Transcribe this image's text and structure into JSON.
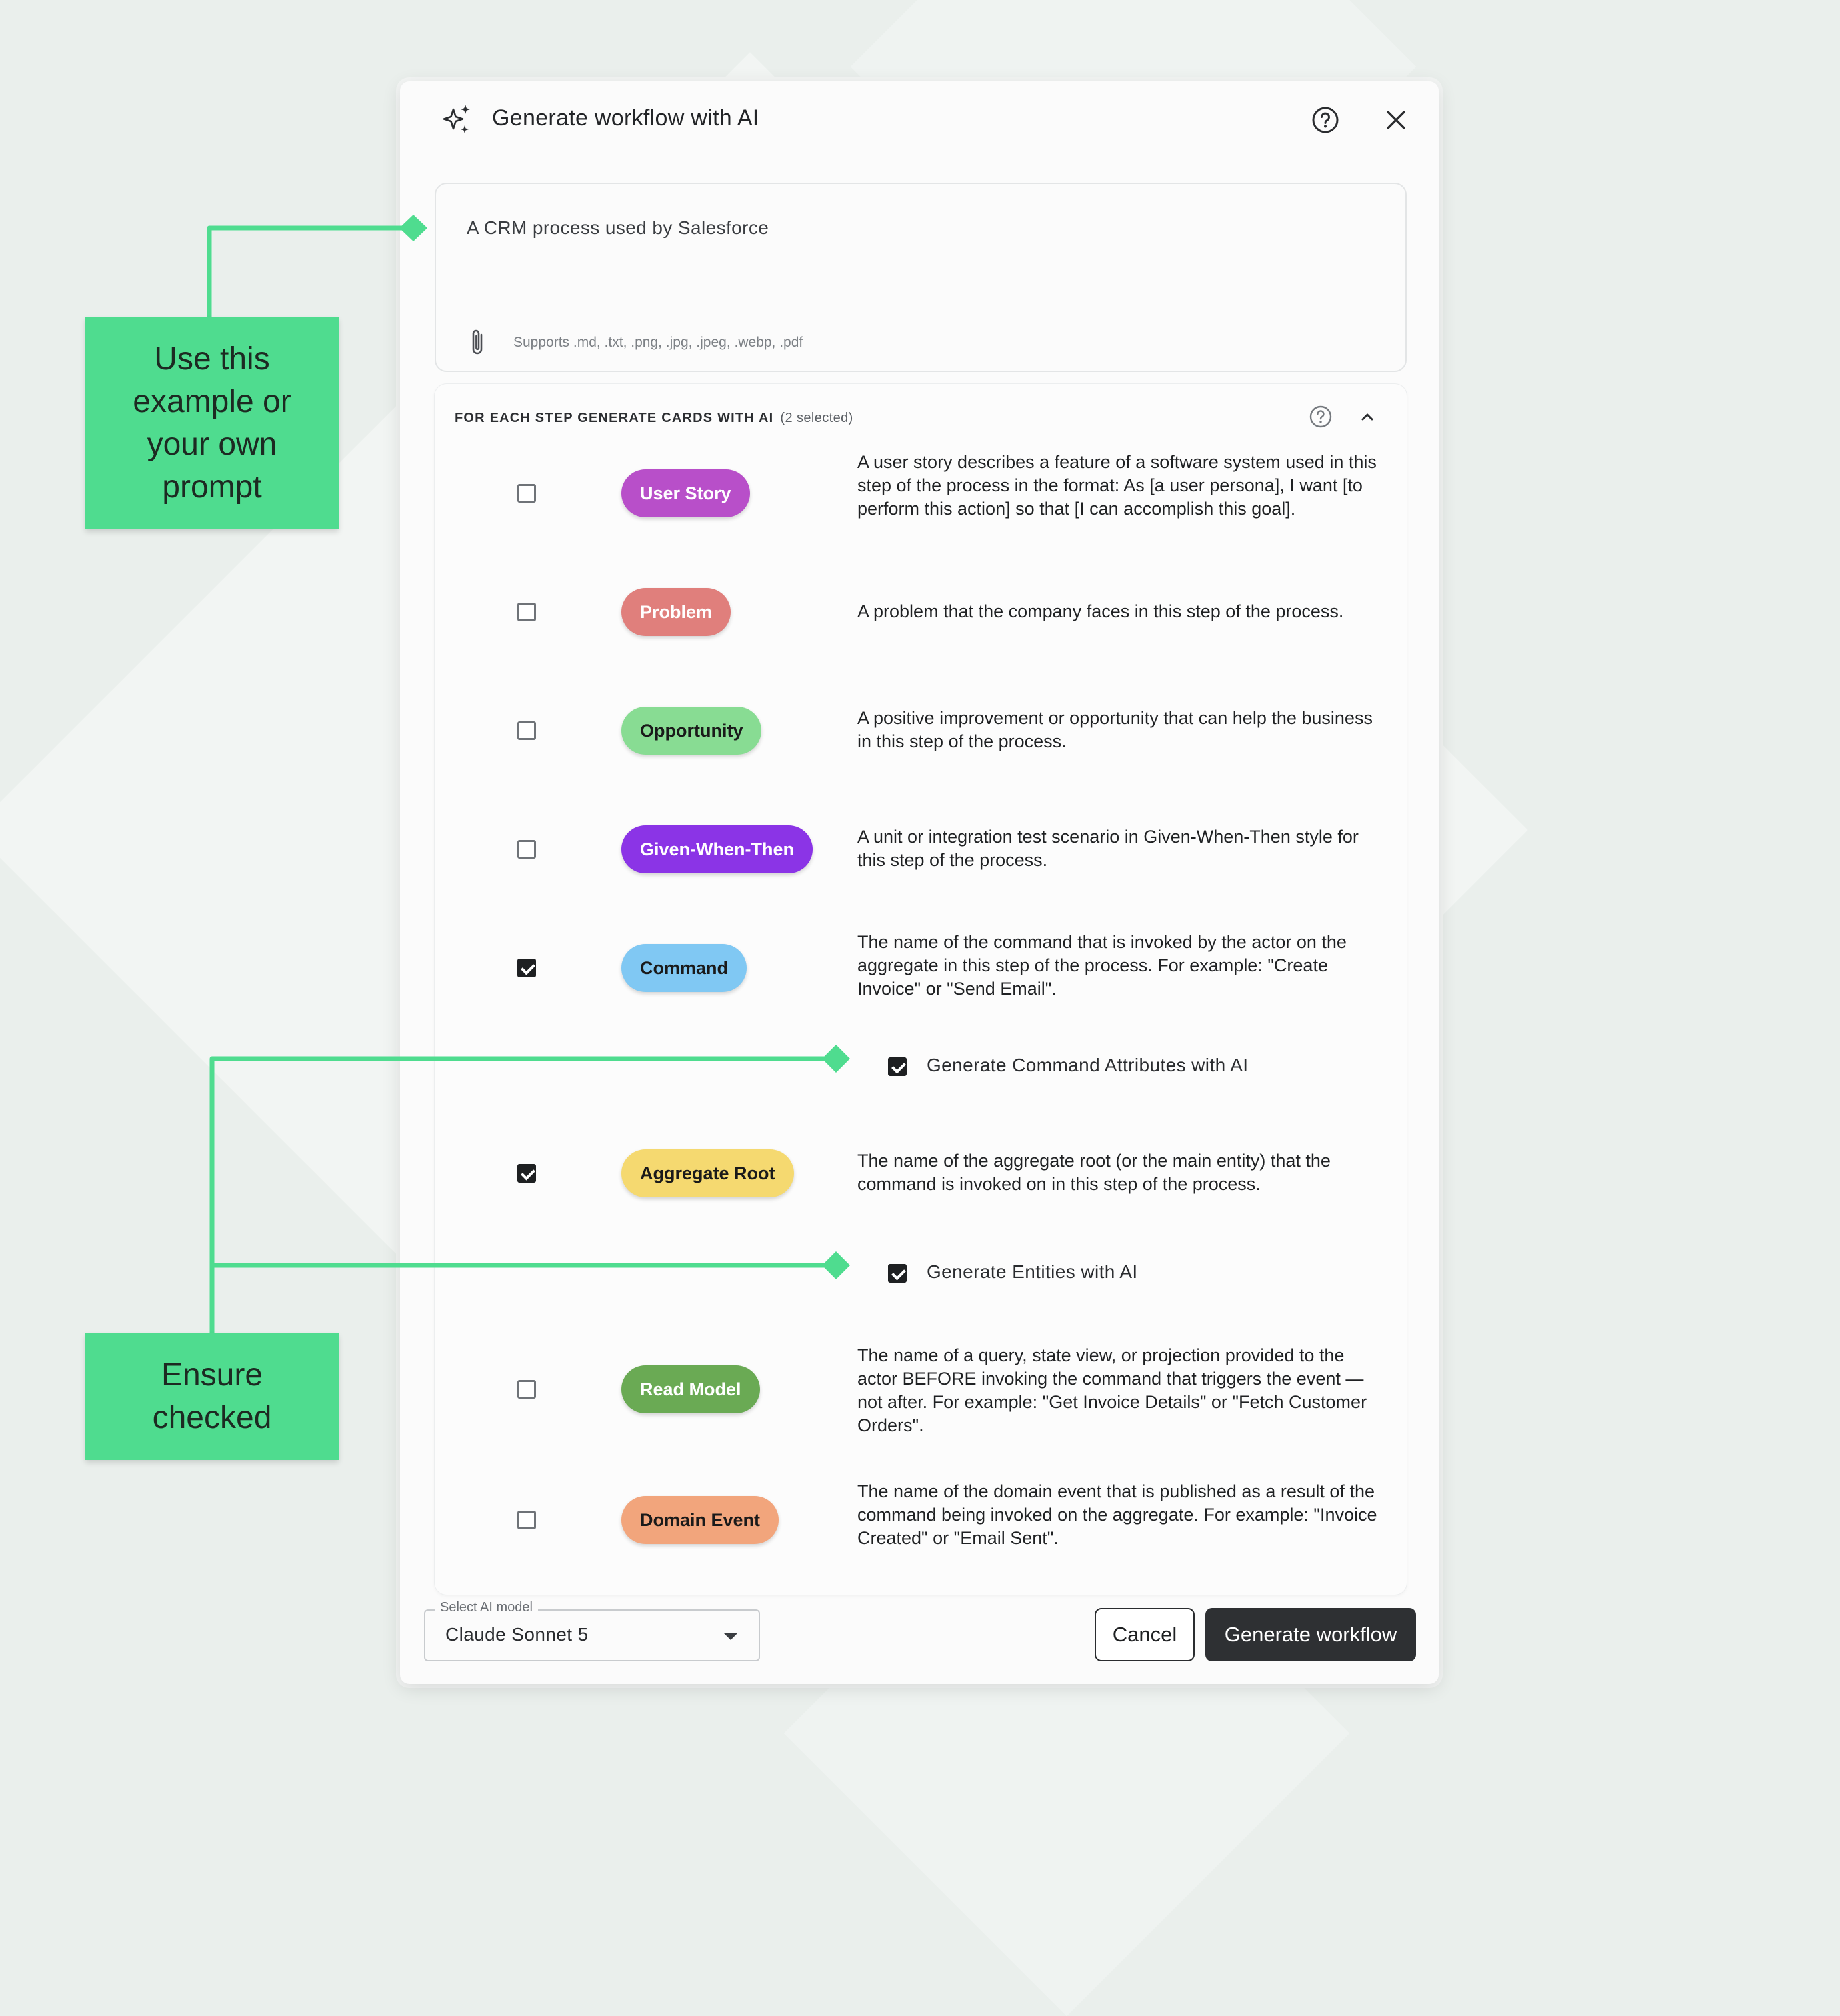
{
  "dialog": {
    "title": "Generate workflow with AI",
    "prompt_value": "A CRM process used by Salesforce",
    "supports_text": "Supports .md, .txt, .png, .jpg, .jpeg, .webp, .pdf"
  },
  "cards_section": {
    "title": "FOR EACH STEP GENERATE CARDS WITH AI",
    "selected_count": "(2 selected)",
    "cards": [
      {
        "label": "User Story",
        "checked": false,
        "color": "#b84fc9",
        "text_color": "#ffffff",
        "description": "A user story describes a feature of a software system used in this step of the process in the format: As [a user persona], I want [to perform this action] so that [I can accomplish this goal]."
      },
      {
        "label": "Problem",
        "checked": false,
        "color": "#e07f7c",
        "text_color": "#ffffff",
        "description": "A problem that the company faces in this step of the process."
      },
      {
        "label": "Opportunity",
        "checked": false,
        "color": "#88dc93",
        "text_color": "#1a1a1a",
        "description": "A positive improvement or opportunity that can help the business in this step of the process."
      },
      {
        "label": "Given-When-Then",
        "checked": false,
        "color": "#8b34e6",
        "text_color": "#ffffff",
        "description": "A unit or integration test scenario in Given-When-Then style for this step of the process."
      },
      {
        "label": "Command",
        "checked": true,
        "color": "#80c8f3",
        "text_color": "#1a1a1a",
        "description": "The name of the command that is invoked by the actor on the aggregate in this step of the process. For example: \"Create Invoice\" or \"Send Email\"."
      },
      {
        "label": "Aggregate Root",
        "checked": true,
        "color": "#f5d970",
        "text_color": "#1a1a1a",
        "description": "The name of the aggregate root (or the main entity) that the command is invoked on in this step of the process."
      },
      {
        "label": "Read Model",
        "checked": false,
        "color": "#6aaa54",
        "text_color": "#ffffff",
        "description": "The name of a query, state view, or projection provided to the actor BEFORE invoking the command that triggers the event — not after. For example: \"Get Invoice Details\" or \"Fetch Customer Orders\"."
      },
      {
        "label": "Domain Event",
        "checked": false,
        "color": "#f2a57c",
        "text_color": "#1a1a1a",
        "description": "The name of the domain event that is published as a result of the command being invoked on the aggregate. For example: \"Invoice Created\" or \"Email Sent\"."
      }
    ],
    "sub_options": [
      {
        "label": "Generate Command Attributes with AI",
        "checked": true
      },
      {
        "label": "Generate Entities with AI",
        "checked": true
      }
    ]
  },
  "footer": {
    "model_legend": "Select AI model",
    "model_value": "Claude Sonnet 5",
    "cancel_label": "Cancel",
    "generate_label": "Generate workflow"
  },
  "annotations": {
    "prompt_callout": [
      "Use this",
      "example or",
      "your own",
      "prompt"
    ],
    "checked_callout": [
      "Ensure",
      "checked"
    ],
    "accent_color": "#4fdc8f"
  },
  "icons": {
    "header": "sparkles-icon",
    "help": "help-circle-icon",
    "close": "close-icon",
    "attach": "paperclip-icon",
    "collapse": "chevron-up-icon",
    "dropdown": "caret-down-icon"
  }
}
